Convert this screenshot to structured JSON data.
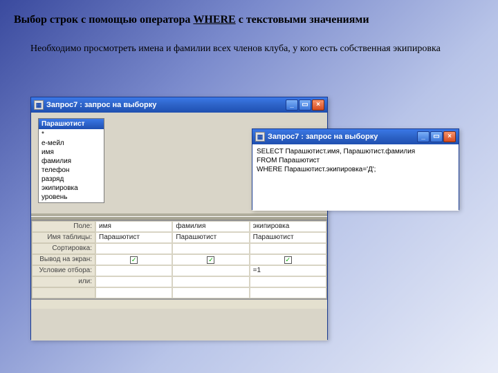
{
  "colors": {
    "xp_blue": "#2d63c7",
    "xp_close": "#d64b1f",
    "panel": "#ece9d8"
  },
  "page": {
    "heading_pre": "Выбор строк с помощью оператора ",
    "heading_kw": "WHERE",
    "heading_post": " с текстовыми значениями",
    "body": "Необходимо просмотреть имена и фамилии всех членов клуба, у кого есть собственная экипировка"
  },
  "design_window": {
    "title": "Запрос7 : запрос на выборку",
    "buttons": {
      "min": "_",
      "max": "▭",
      "close": "×"
    },
    "fieldlist": {
      "title": "Парашютист",
      "fields": [
        "*",
        "е-мейл",
        "имя",
        "фамилия",
        "телефон",
        "разряд",
        "экипировка",
        "уровень"
      ]
    },
    "grid": {
      "labels": {
        "field": "Поле:",
        "table": "Имя таблицы:",
        "sort": "Сортировка:",
        "show": "Вывод на экран:",
        "criteria": "Условие отбора:",
        "or": "или:"
      },
      "cols": [
        {
          "field": "имя",
          "table": "Парашютист",
          "sort": "",
          "show": true,
          "criteria": "",
          "or": ""
        },
        {
          "field": "фамилия",
          "table": "Парашютист",
          "sort": "",
          "show": true,
          "criteria": "",
          "or": ""
        },
        {
          "field": "экипировка",
          "table": "Парашютист",
          "sort": "",
          "show": true,
          "criteria": "=1",
          "or": ""
        }
      ]
    }
  },
  "sql_window": {
    "title": "Запрос7 : запрос на выборку",
    "buttons": {
      "min": "_",
      "max": "▭",
      "close": "×"
    },
    "lines": [
      "SELECT Парашютист.имя, Парашютист.фамилия",
      "FROM Парашютист",
      "WHERE Парашютист.экипировка='Д';"
    ]
  }
}
